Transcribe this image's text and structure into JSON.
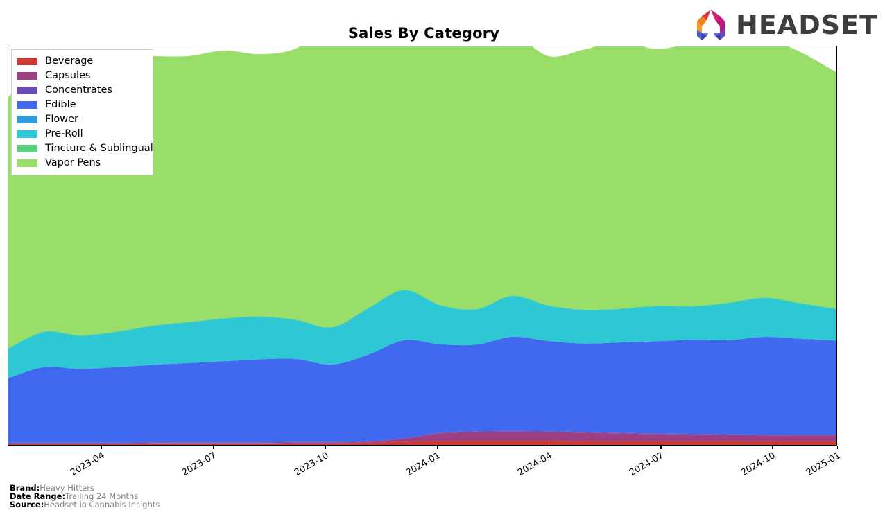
{
  "header": {
    "title": "Sales By Category",
    "logo_word": "HEADSET",
    "logo_mark_name": "headset-arch-logo"
  },
  "legend": {
    "position": "upper-left",
    "items": [
      {
        "label": "Beverage",
        "color": "#c93b33"
      },
      {
        "label": "Capsules",
        "color": "#9c3f84"
      },
      {
        "label": "Concentrates",
        "color": "#6b4bb5"
      },
      {
        "label": "Edible",
        "color": "#4169f0"
      },
      {
        "label": "Flower",
        "color": "#339add"
      },
      {
        "label": "Pre-Roll",
        "color": "#2ec8d4"
      },
      {
        "label": "Tincture & Sublingual",
        "color": "#5fd07f"
      },
      {
        "label": "Vapor Pens",
        "color": "#9ade6a"
      }
    ]
  },
  "axis": {
    "x_ticks": [
      "2023-04",
      "2023-07",
      "2023-10",
      "2024-01",
      "2024-04",
      "2024-07",
      "2024-10",
      "2025-01"
    ],
    "x_tick_positions": [
      0.113,
      0.2478,
      0.3826,
      0.5174,
      0.6522,
      0.787,
      0.9217,
      1.0
    ],
    "y_tick_labels": [],
    "grid": false
  },
  "footer": {
    "rows": [
      {
        "label": "Brand:",
        "value": "Heavy Hitters"
      },
      {
        "label": "Date Range:",
        "value": "Trailing 24 Months"
      },
      {
        "label": "Source:",
        "value": "Headset.io Cannabis Insights"
      }
    ]
  },
  "chart_data": {
    "type": "area",
    "stacked": true,
    "title": "Sales By Category",
    "xlabel": "",
    "ylabel": "",
    "grid": false,
    "x": [
      "2023-01",
      "2023-02",
      "2023-03",
      "2023-04",
      "2023-05",
      "2023-06",
      "2023-07",
      "2023-08",
      "2023-09",
      "2023-10",
      "2023-11",
      "2023-12",
      "2024-01",
      "2024-02",
      "2024-03",
      "2024-04",
      "2024-05",
      "2024-06",
      "2024-07",
      "2024-08",
      "2024-09",
      "2024-10",
      "2024-11",
      "2024-12"
    ],
    "units": "relative sales (unlabeled y-axis)",
    "ylim": [
      0,
      100
    ],
    "series": [
      {
        "name": "Beverage",
        "color": "#c93b33",
        "values": [
          0.3,
          0.3,
          0.3,
          0.3,
          0.4,
          0.4,
          0.4,
          0.4,
          0.5,
          0.5,
          0.6,
          0.9,
          1.1,
          1.1,
          1.1,
          1.1,
          1.0,
          1.0,
          1.0,
          1.0,
          1.0,
          1.0,
          1.0,
          1.0
        ]
      },
      {
        "name": "Capsules",
        "color": "#9c3f84",
        "values": [
          0.1,
          0.1,
          0.1,
          0.1,
          0.1,
          0.1,
          0.1,
          0.1,
          0.1,
          0.1,
          0.2,
          0.8,
          2.0,
          2.4,
          2.5,
          2.4,
          2.3,
          2.1,
          1.9,
          1.8,
          1.7,
          1.6,
          1.6,
          1.6
        ]
      },
      {
        "name": "Concentrates",
        "color": "#6b4bb5",
        "values": [
          0.2,
          0.2,
          0.2,
          0.2,
          0.2,
          0.2,
          0.2,
          0.2,
          0.2,
          0.2,
          0.2,
          0.2,
          0.2,
          0.2,
          0.2,
          0.2,
          0.2,
          0.2,
          0.2,
          0.2,
          0.2,
          0.2,
          0.2,
          0.2
        ]
      },
      {
        "name": "Edible",
        "color": "#4169f0",
        "values": [
          17.5,
          20.5,
          20.0,
          20.5,
          21.0,
          21.5,
          22.0,
          22.5,
          22.5,
          21.0,
          23.5,
          26.5,
          24.0,
          23.5,
          25.5,
          24.5,
          24.0,
          24.5,
          25.0,
          25.5,
          25.5,
          26.5,
          26.0,
          25.5
        ]
      },
      {
        "name": "Flower",
        "color": "#339add",
        "values": [
          0.0,
          0.0,
          0.0,
          0.0,
          0.0,
          0.0,
          0.0,
          0.0,
          0.0,
          0.0,
          0.0,
          0.0,
          0.0,
          0.0,
          0.0,
          0.0,
          0.0,
          0.0,
          0.0,
          0.0,
          0.0,
          0.0,
          0.0,
          0.0
        ]
      },
      {
        "name": "Pre-Roll",
        "color": "#2ec8d4",
        "values": [
          8.0,
          9.5,
          9.0,
          9.5,
          10.5,
          11.0,
          11.5,
          11.5,
          10.5,
          10.0,
          12.5,
          13.5,
          10.5,
          9.5,
          11.0,
          9.5,
          9.0,
          9.0,
          9.5,
          9.0,
          10.0,
          10.5,
          9.5,
          8.5
        ]
      },
      {
        "name": "Tincture & Sublingual",
        "color": "#5fd07f",
        "values": [
          0.2,
          0.2,
          0.2,
          0.2,
          0.2,
          0.2,
          0.2,
          0.2,
          0.2,
          0.2,
          0.2,
          0.2,
          0.2,
          0.2,
          0.2,
          0.2,
          0.2,
          0.2,
          0.2,
          0.2,
          0.2,
          0.2,
          0.2,
          0.2
        ]
      },
      {
        "name": "Vapor Pens",
        "color": "#9ade6a",
        "values": [
          68.0,
          72.0,
          74.5,
          75.0,
          73.0,
          72.0,
          72.5,
          71.0,
          73.5,
          82.5,
          74.0,
          68.5,
          73.5,
          77.0,
          71.5,
          67.5,
          70.5,
          72.5,
          69.5,
          71.5,
          74.0,
          70.5,
          68.0,
          64.0
        ]
      }
    ]
  }
}
